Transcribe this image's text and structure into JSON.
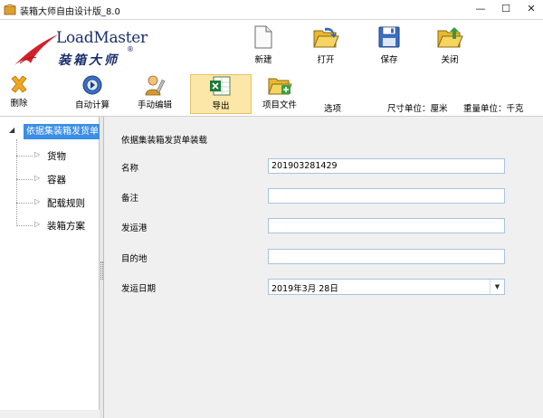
{
  "window": {
    "title": "装箱大师自由设计版_8.0",
    "min_glyph": "—",
    "max_glyph": "☐",
    "close_glyph": "✕"
  },
  "logo": {
    "en": "LoadMaster",
    "reg": "®",
    "cn": "装箱大师"
  },
  "toolbar_big": [
    {
      "label": "新建",
      "icon": "new-file-icon"
    },
    {
      "label": "打开",
      "icon": "open-folder-icon"
    },
    {
      "label": "保存",
      "icon": "save-disk-icon"
    },
    {
      "label": "关闭",
      "icon": "close-folder-icon"
    }
  ],
  "toolbar_small": [
    {
      "label": "删除",
      "icon": "delete-x-icon"
    },
    {
      "label": "自动计算",
      "icon": "auto-calc-icon"
    },
    {
      "label": "手动编辑",
      "icon": "manual-edit-icon"
    },
    {
      "label": "导出",
      "icon": "export-excel-icon",
      "active": true
    },
    {
      "label": "项目文件",
      "icon": "project-folder-icon"
    }
  ],
  "options_label": "选项",
  "units": {
    "size": "尺寸单位：厘米",
    "weight": "重量单位：千克"
  },
  "tree": {
    "root": "依据集装箱发货单",
    "items": [
      "货物",
      "容器",
      "配载规则",
      "装箱方案"
    ]
  },
  "form": {
    "title": "依据集装箱发货单装载",
    "fields": [
      {
        "label": "名称",
        "value": "201903281429"
      },
      {
        "label": "备注",
        "value": ""
      },
      {
        "label": "发运港",
        "value": ""
      },
      {
        "label": "目的地",
        "value": ""
      }
    ],
    "date_label": "发运日期",
    "date_value": "2019年3月 28日"
  },
  "colors": {
    "selection": "#3a8ee6",
    "active_button": "#fde7a8",
    "logo_blue": "#1a2e6e",
    "logo_red": "#d4202a"
  }
}
